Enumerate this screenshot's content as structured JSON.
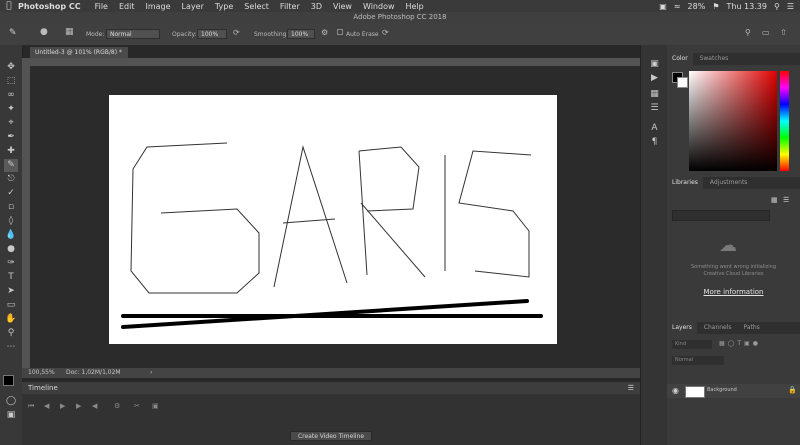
{
  "menubar": {
    "apple": "",
    "app_name": "Photoshop CC",
    "items": [
      "File",
      "Edit",
      "Image",
      "Layer",
      "Type",
      "Select",
      "Filter",
      "3D",
      "View",
      "Window",
      "Help"
    ],
    "clock": "Thu 13.39",
    "battery": "28%"
  },
  "window_title": "Adobe Photoshop CC 2018",
  "options_bar": {
    "mode_label": "Mode:",
    "mode_value": "Normal",
    "opacity_label": "Opacity:",
    "opacity_value": "100%",
    "smoothing_label": "Smoothing:",
    "smoothing_value": "100%",
    "auto_erase_label": "Auto Erase"
  },
  "document_tab": "Untitled-3 @ 101% (RGB/8) *",
  "status": {
    "zoom": "100,55%",
    "doc_info": "Doc: 1,02M/1,02M"
  },
  "timeline": {
    "title": "Timeline",
    "button": "Create Video Timeline"
  },
  "color_panel": {
    "tabs": [
      "Color",
      "Swatches"
    ]
  },
  "libraries_panel": {
    "tabs": [
      "Libraries",
      "Adjustments"
    ],
    "message_line1": "Something went wrong initializing",
    "message_line2": "Creative Cloud Libraries",
    "link": "More information"
  },
  "layers_panel": {
    "tabs": [
      "Layers",
      "Channels",
      "Paths"
    ],
    "search_placeholder": "Kind",
    "blend_mode": "Normal",
    "layer_name": "Background"
  },
  "canvas_text": "GARIS",
  "colors": {
    "accent": "#1473e6",
    "canvas": "#ffffff",
    "workspace": "#2b2b2b"
  }
}
